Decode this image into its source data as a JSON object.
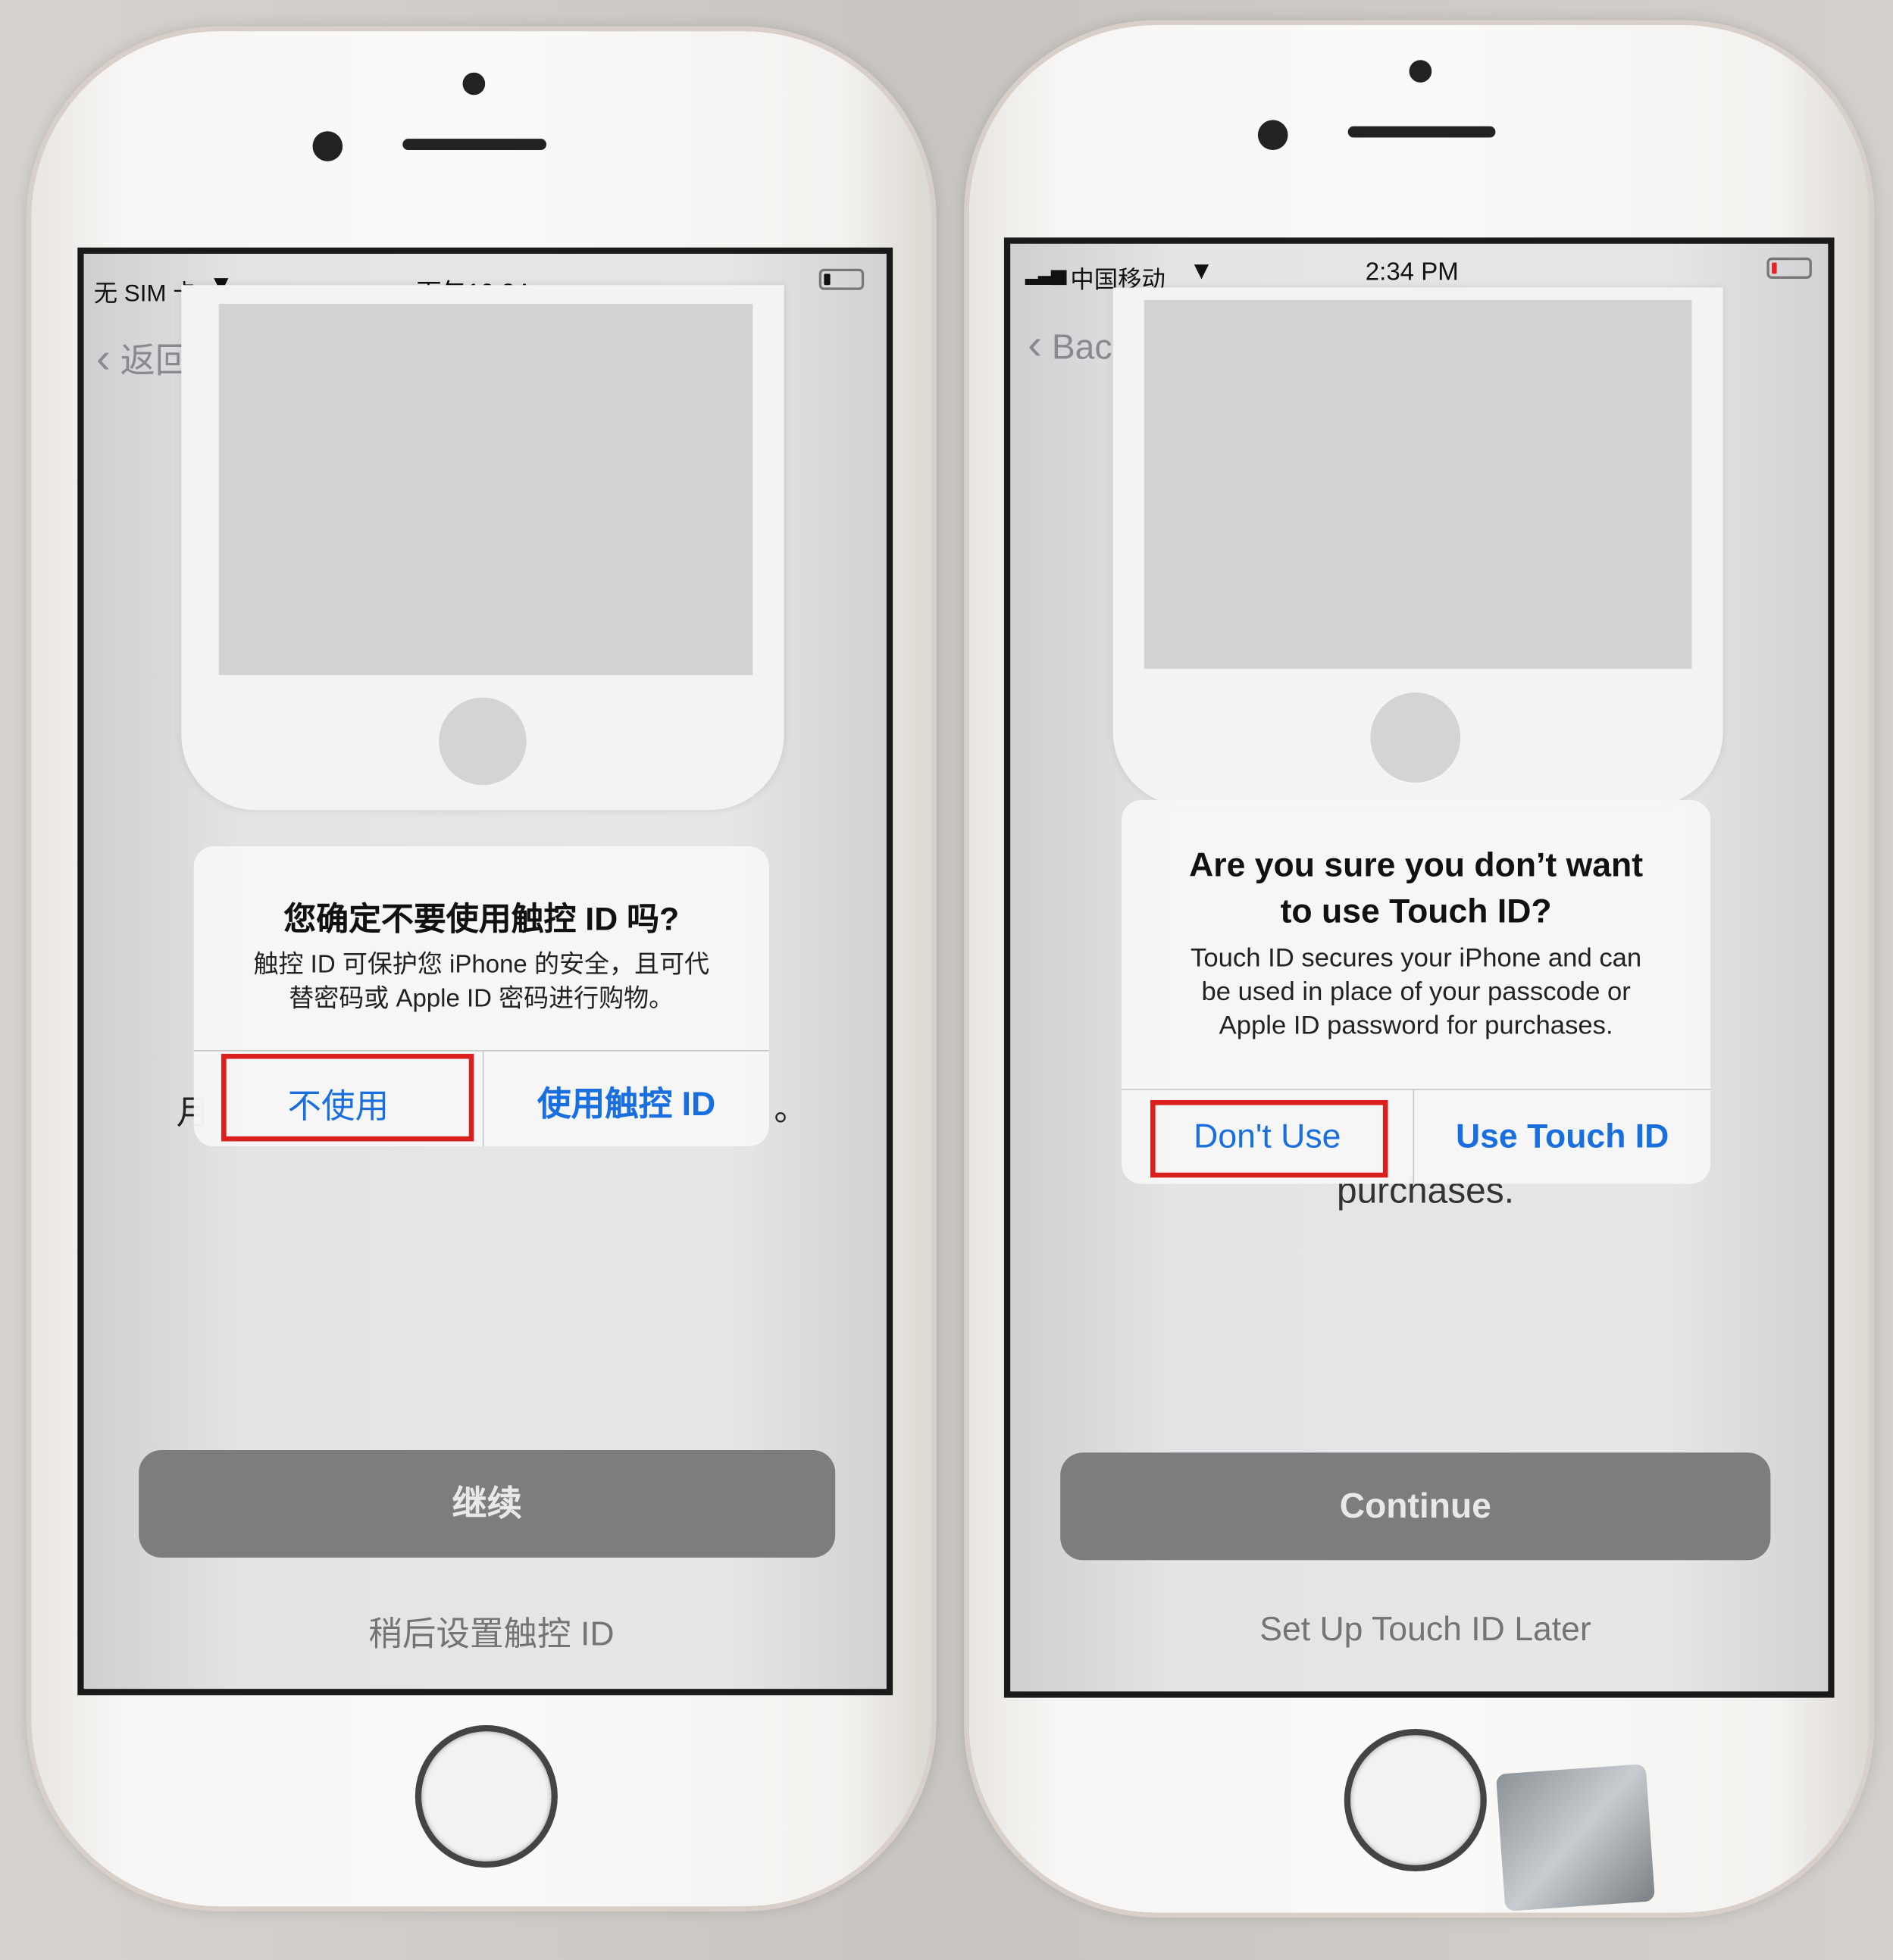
{
  "left_phone": {
    "status": {
      "carrier": "无 SIM 卡",
      "time": "下午10:34",
      "wifi_icon": "wifi-icon",
      "battery_icon": "battery-low-icon"
    },
    "back_label": "返回",
    "alert": {
      "title": "您确定不要使用触控 ID 吗?",
      "body_line1": "触控 ID 可保护您 iPhone 的安全，且可代",
      "body_line2": "替密码或 Apple ID 密码进行购物。",
      "dont_use": "不使用",
      "use": "使用触控 ID"
    },
    "behind_left": "月",
    "behind_right": "。",
    "continue_label": "继续",
    "later_label": "稍后设置触控 ID"
  },
  "right_phone": {
    "status": {
      "carrier": "中国移动",
      "time": "2:34 PM",
      "signal_icon": "signal-icon",
      "wifi_icon": "wifi-icon",
      "battery_icon": "battery-low-icon"
    },
    "back_label": "Back",
    "alert": {
      "title_line1": "Are you sure you don’t want",
      "title_line2": "to use Touch ID?",
      "body_line1": "Touch ID secures your iPhone and can",
      "body_line2": "be used in place of your passcode or",
      "body_line3": "Apple ID password for purchases.",
      "dont_use": "Don't Use",
      "use": "Use Touch ID"
    },
    "behind_text": "purchases.",
    "continue_label": "Continue",
    "later_label": "Set Up Touch ID Later"
  },
  "colors": {
    "accent": "#1a6fe0",
    "highlight_box": "#d9201d",
    "battery_low": "#e0282a"
  }
}
